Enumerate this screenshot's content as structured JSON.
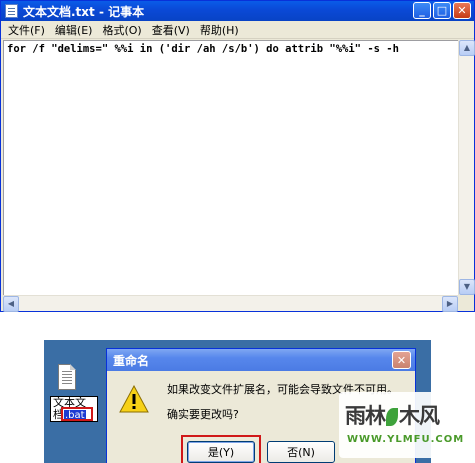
{
  "notepad": {
    "title": "文本文档.txt - 记事本",
    "menu": [
      "文件(F)",
      "编辑(E)",
      "格式(O)",
      "查看(V)",
      "帮助(H)"
    ],
    "content": "for /f \"delims=\" %%i in ('dir /ah /s/b') do attrib \"%%i\" -s -h",
    "controls": {
      "minimize": "_",
      "maximize": "□",
      "close": "✕"
    }
  },
  "desktop": {
    "rename_line1": "文本文",
    "rename_line2_prefix": "档",
    "rename_selected": ".bat"
  },
  "dialog": {
    "title": "重命名",
    "message": "如果改变文件扩展名，可能会导致文件不可用。",
    "question": "确实要更改吗?",
    "yes_label": "是(Y)",
    "no_label": "否(N)",
    "close": "✕"
  },
  "watermark": {
    "main_left": "雨林",
    "main_right": "木风",
    "sub": "WWW.YLMFU.COM"
  }
}
